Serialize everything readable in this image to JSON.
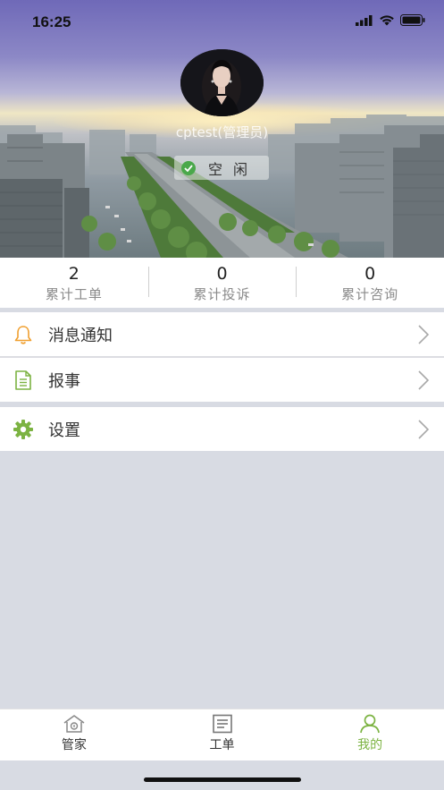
{
  "status_bar": {
    "time": "16:25"
  },
  "profile": {
    "user_name": "cptest(管理员)",
    "status_text": "空闲"
  },
  "stats": [
    {
      "value": "2",
      "label": "累计工单"
    },
    {
      "value": "0",
      "label": "累计投诉"
    },
    {
      "value": "0",
      "label": "累计咨询"
    }
  ],
  "menu": {
    "notifications": {
      "label": "消息通知",
      "icon": "bell-icon"
    },
    "report": {
      "label": "报事",
      "icon": "document-icon"
    },
    "settings": {
      "label": "设置",
      "icon": "gear-icon"
    }
  },
  "tabbar": [
    {
      "label": "管家",
      "icon": "house-icon",
      "active": false
    },
    {
      "label": "工单",
      "icon": "list-icon",
      "active": false
    },
    {
      "label": "我的",
      "icon": "person-icon",
      "active": true
    }
  ],
  "colors": {
    "accent": "#7cb342",
    "bell": "#f0a030",
    "status_check": "#4aa84a"
  }
}
